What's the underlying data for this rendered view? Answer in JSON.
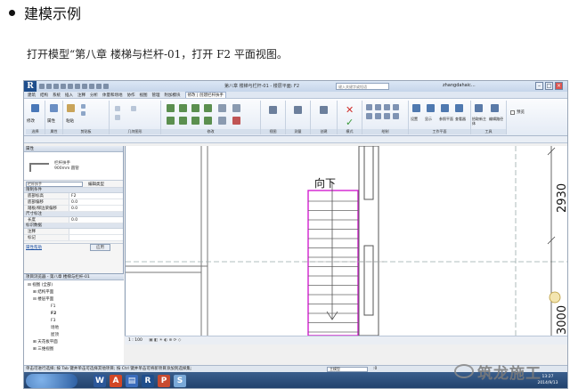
{
  "slide": {
    "title": "建模示例",
    "instruction": "打开模型“第八章 楼梯与栏杆-01，打开 F2 平面视图。"
  },
  "app": {
    "logo": "R",
    "window_title": "第八章 楼梯与栏杆-01 - 楼层平面: F2",
    "search_placeholder": "键入关键字或短语",
    "user": "zhangdahaic…",
    "tabs": [
      "建筑",
      "结构",
      "系统",
      "插入",
      "注释",
      "分析",
      "体量和场地",
      "协作",
      "视图",
      "管理",
      "附加模块",
      "修改 | 创建栏杆扶手"
    ],
    "ribbon_groups": [
      "选择",
      "属性",
      "剪贴板",
      "几何图形",
      "修改",
      "视图",
      "测量",
      "创建",
      "模式",
      "绘制",
      "工作平面",
      "工具"
    ],
    "ribbon_labels": [
      "修改",
      "属性",
      "粘贴",
      "设置",
      "显示",
      "参照平面",
      "查看器",
      "拾取新主体",
      "编辑路径",
      "预览"
    ]
  },
  "properties": {
    "header": "属性",
    "type_name_line1": "栏杆扶手",
    "type_name_line2": "900mm 圆管",
    "family_selector": "栏杆扶手",
    "edit_type": "编辑类型",
    "cat_constraints": "限制条件",
    "rows_constraints": [
      {
        "label": "底部标高",
        "value": "F2"
      },
      {
        "label": "底部偏移",
        "value": "0.0"
      },
      {
        "label": "踏板/梯边梁偏移",
        "value": "0.0"
      }
    ],
    "cat_dimensions": "尺寸标注",
    "rows_dimensions": [
      {
        "label": "长度",
        "value": "0.0"
      }
    ],
    "cat_identity": "标识数据",
    "rows_identity": [
      {
        "label": "注释",
        "value": ""
      },
      {
        "label": "标记",
        "value": ""
      }
    ],
    "help_link": "属性帮助",
    "apply_button": "应用"
  },
  "browser": {
    "header": "项目浏览器 - 第八章 楼梯与栏杆-01",
    "nodes": [
      {
        "label": "视图 (全部)",
        "level": 0
      },
      {
        "label": "结构平面",
        "level": 1
      },
      {
        "label": "楼层平面",
        "level": 1
      },
      {
        "label": "F1",
        "level": 3
      },
      {
        "label": "F2",
        "level": 3
      },
      {
        "label": "F3",
        "level": 3
      },
      {
        "label": "场地",
        "level": 3
      },
      {
        "label": "屋顶",
        "level": 3
      },
      {
        "label": "天花板平面",
        "level": 1
      },
      {
        "label": "三维视图",
        "level": 1
      }
    ]
  },
  "canvas": {
    "stair_label": "向下",
    "dim_top": "2930",
    "dim_bottom": "3000",
    "accent_color": "#d21ecf"
  },
  "view_control": {
    "scale": "1 : 100"
  },
  "status": {
    "text": "单击可进行选择; 按 Tab 键并单击可选择其他项目; 按 Ctrl 键并单击可将新项目添加到选择集;",
    "model_combo": "主模型",
    "count": ":0"
  },
  "taskbar": {
    "start_label": "",
    "time": "13:27",
    "date": "2014/9/13"
  },
  "watermark": {
    "text": "筑龙施工"
  }
}
